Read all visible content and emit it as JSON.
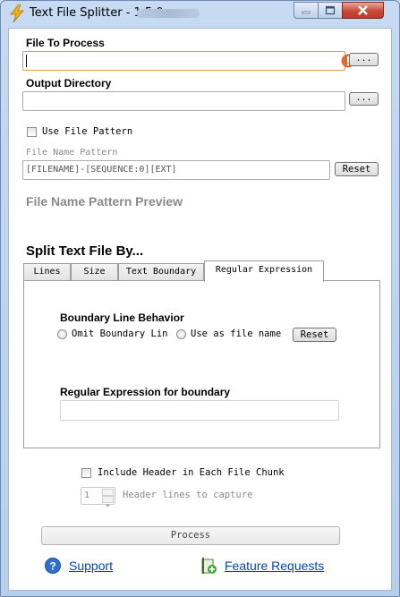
{
  "window": {
    "title": "Text File Splitter - 1.5.0"
  },
  "file_to_process": {
    "label": "File To Process",
    "value": "",
    "browse_label": "..."
  },
  "output_directory": {
    "label": "Output Directory",
    "value": "",
    "browse_label": "..."
  },
  "use_file_pattern": {
    "label": "Use File Pattern",
    "checked": false
  },
  "file_name_pattern": {
    "label": "File Name Pattern",
    "value": "[FILENAME]-[SEQUENCE:0][EXT]",
    "reset_label": "Reset"
  },
  "pattern_preview": {
    "label": "File Name Pattern Preview"
  },
  "split_by": {
    "heading": "Split Text File By...",
    "tabs": [
      "Lines",
      "Size",
      "Text Boundary",
      "Regular Expression"
    ],
    "active_tab": "Regular Expression"
  },
  "regex_panel": {
    "boundary_heading": "Boundary Line Behavior",
    "omit_label": "Omit Boundary Lin",
    "use_filename_label": "Use as file name",
    "reset_label": "Reset",
    "regex_label": "Regular Expression for boundary",
    "regex_value": ""
  },
  "header": {
    "include_label": "Include Header in Each File Chunk",
    "include_checked": false,
    "lines_value": "1",
    "lines_label": "Header lines to capture"
  },
  "process_label": "Process",
  "links": {
    "support": "Support",
    "feature_requests": "Feature Requests"
  },
  "colors": {
    "link": "#0645ad",
    "disabled_text": "#8a8a8a",
    "warning_icon": "#e46a2c",
    "textbox_focus": "#e0a13a"
  },
  "icons": [
    "lightning-icon",
    "warning-icon",
    "help-icon",
    "feature-request-icon"
  ]
}
